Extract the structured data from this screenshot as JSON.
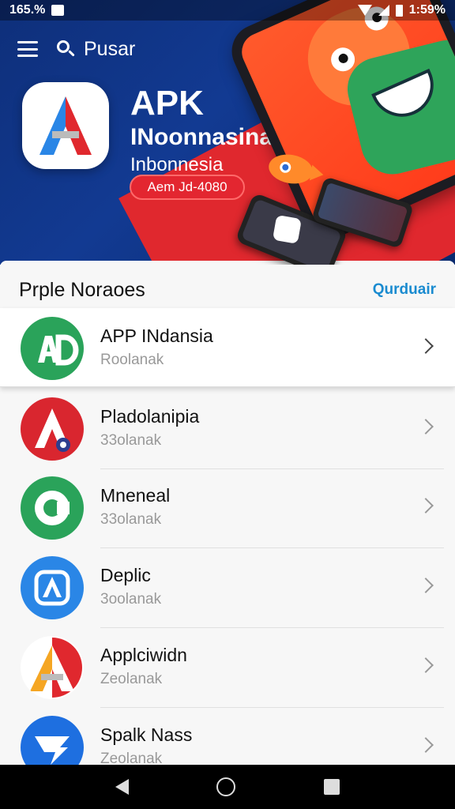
{
  "status_bar": {
    "left_text": "165.%",
    "right_text": "1:59%"
  },
  "top_bar": {
    "search_label": "Pusar"
  },
  "hero": {
    "title": "APK",
    "subtitle_1": "INoonnasina",
    "subtitle_2": "Inbonnesia",
    "button_label": "Aem Jd-4080"
  },
  "section": {
    "title": "Prple Noraoes",
    "link_label": "Qurduair"
  },
  "apps": [
    {
      "name": "APP INdansia",
      "sub": "Roolanak",
      "icon": "apk-green-icon",
      "color": "#2aa35a"
    },
    {
      "name": "Pladolanipia",
      "sub": "33olanak",
      "icon": "apk-red-icon",
      "color": "#d9262f"
    },
    {
      "name": "Mneneal",
      "sub": "33olanak",
      "icon": "apk-green-ring-icon",
      "color": "#2aa35a"
    },
    {
      "name": "Deplic",
      "sub": "3oolanak",
      "icon": "apk-blue-icon",
      "color": "#2a86e6"
    },
    {
      "name": "Applciwidn",
      "sub": "Zeolanak",
      "icon": "apk-orange-icon",
      "color": "#f28a1e"
    },
    {
      "name": "Spalk Nass",
      "sub": "Zeolanak",
      "icon": "apk-blue-bird-icon",
      "color": "#1e6fe0"
    }
  ],
  "nav": {
    "back": "back-icon",
    "home": "home-icon",
    "recent": "recent-apps-icon"
  }
}
